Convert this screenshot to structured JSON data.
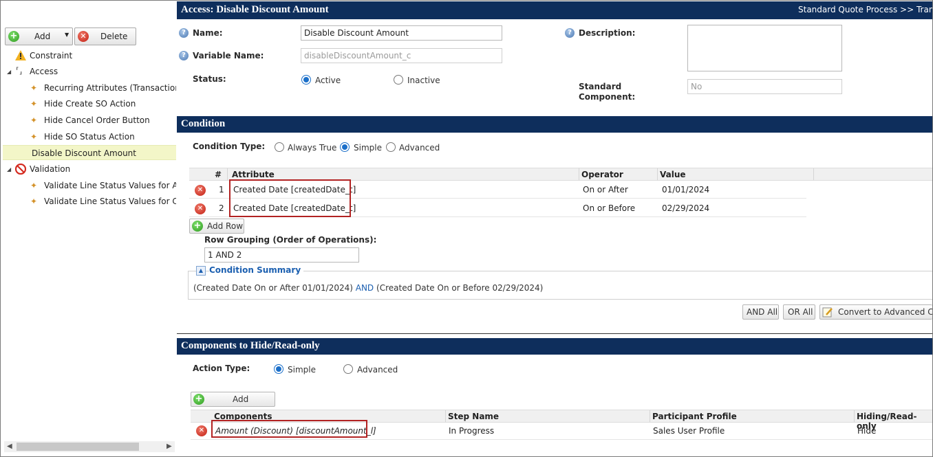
{
  "toolbar": {
    "add_label": "Add",
    "delete_label": "Delete"
  },
  "tree": {
    "constraint": "Constraint",
    "access": "Access",
    "access_items": [
      "Recurring Attributes (Transaction)",
      "Hide Create SO Action",
      "Hide Cancel Order Button",
      "Hide SO Status Action"
    ],
    "selected": "Disable Discount Amount",
    "validation": "Validation",
    "validation_items": [
      "Validate Line Status Values for Asse",
      "Validate Line Status Values for Canc"
    ]
  },
  "header": {
    "title": "Access: Disable Discount Amount",
    "breadcrumb": "Standard Quote Process >> Transac"
  },
  "form": {
    "name_label": "Name:",
    "name_value": "Disable Discount Amount",
    "varname_label": "Variable Name:",
    "varname_value": "disableDiscountAmount_c",
    "status_label": "Status:",
    "status_active": "Active",
    "status_inactive": "Inactive",
    "status_selected": "Active",
    "description_label": "Description:",
    "description_value": "",
    "standard_label_1": "Standard",
    "standard_label_2": "Component:",
    "standard_value": "No"
  },
  "condition": {
    "section_title": "Condition",
    "type_label": "Condition Type:",
    "types": [
      "Always True",
      "Simple",
      "Advanced"
    ],
    "type_selected": "Simple",
    "columns": {
      "num": "#",
      "attribute": "Attribute",
      "operator": "Operator",
      "value": "Value"
    },
    "rows": [
      {
        "num": "1",
        "attribute": "Created Date [createdDate_t]",
        "operator": "On or After",
        "value": "01/01/2024"
      },
      {
        "num": "2",
        "attribute": "Created Date [createdDate_t]",
        "operator": "On or Before",
        "value": "02/29/2024"
      }
    ],
    "add_row_label": "Add Row",
    "grouping_label": "Row Grouping (Order of Operations):",
    "grouping_value": "1 AND 2",
    "summary_title": "Condition Summary",
    "summary_part1": "(Created Date On or After 01/01/2024)",
    "summary_and": "AND",
    "summary_part2": "(Created Date On or Before 02/29/2024)",
    "and_all_label": "AND All",
    "or_all_label": "OR All",
    "convert_label": "Convert to Advanced Con"
  },
  "components": {
    "section_title": "Components to Hide/Read-only",
    "action_type_label": "Action Type:",
    "action_simple": "Simple",
    "action_advanced": "Advanced",
    "action_selected": "Simple",
    "add_label": "Add",
    "columns": {
      "components": "Components",
      "step": "Step Name",
      "profile": "Participant Profile",
      "hiding": "Hiding/Read-only"
    },
    "rows": [
      {
        "component": "Amount (Discount) [discountAmount_l]",
        "step": "In Progress",
        "profile": "Sales User Profile",
        "hiding": "Hide"
      }
    ]
  },
  "colors": {
    "header_bg": "#0e2e5c",
    "selected_bg": "#f3f6c8",
    "highlight_border": "#b22222",
    "link_blue": "#1b5fb0"
  }
}
